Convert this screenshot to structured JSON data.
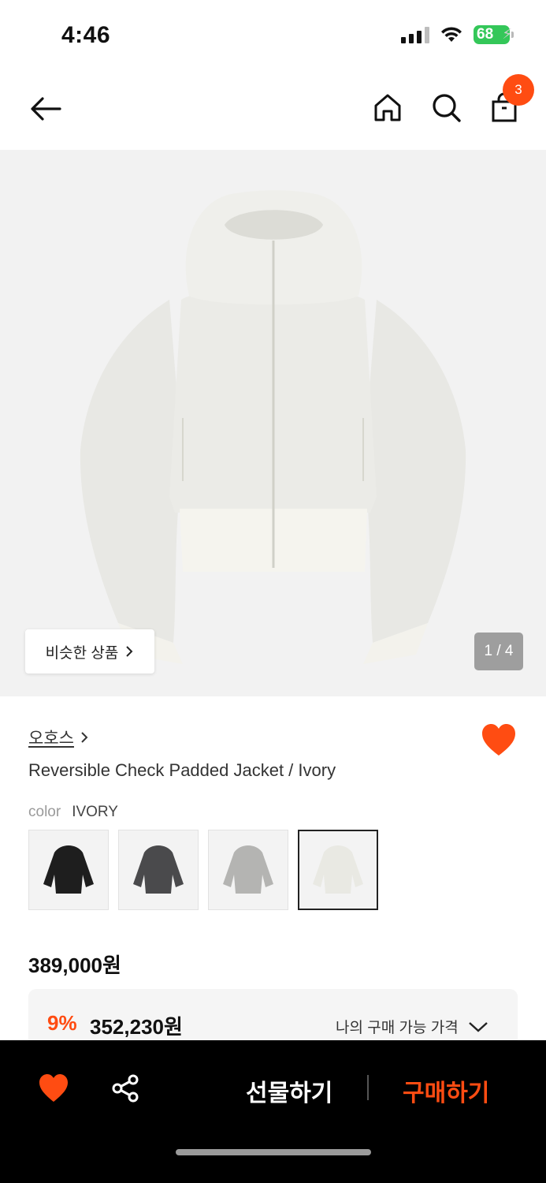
{
  "status_bar": {
    "time": "4:46",
    "battery": "68"
  },
  "header": {
    "cart_count": "3"
  },
  "hero": {
    "similar_label": "비슷한 상품",
    "page_counter": "1 / 4"
  },
  "product": {
    "brand": "오호스",
    "title": "Reversible Check Padded Jacket / Ivory",
    "color_label": "color",
    "color_value": "IVORY",
    "swatches": [
      "black",
      "charcoal",
      "gray",
      "ivory"
    ],
    "original_price": "389,000원",
    "discount_rate": "9%",
    "discount_price": "352,230원",
    "my_price_label": "나의 구매 가능 가격"
  },
  "bottom_bar": {
    "gift_label": "선물하기",
    "buy_label": "구매하기"
  },
  "colors": {
    "accent": "#ff4c12",
    "battery": "#34c759"
  }
}
